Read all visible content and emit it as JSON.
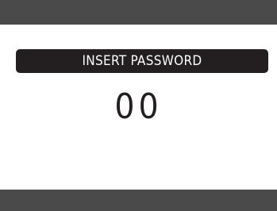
{
  "prompt": {
    "label": "INSERT PASSWORD"
  },
  "password": {
    "value": "00"
  },
  "colors": {
    "bar": "#4a4a4a",
    "label_bg": "#231f20",
    "text_dark": "#231f20",
    "background": "#ffffff"
  }
}
